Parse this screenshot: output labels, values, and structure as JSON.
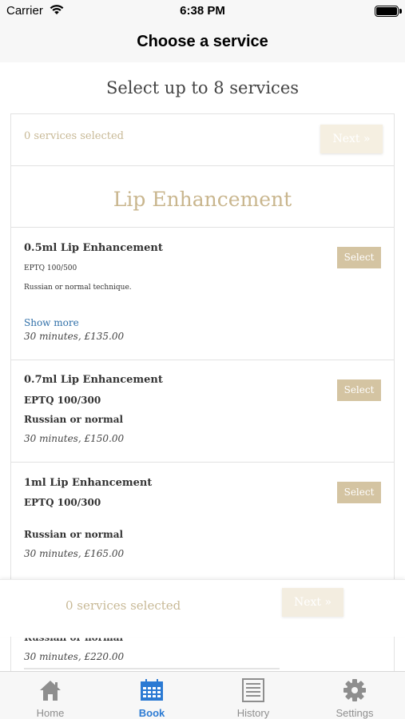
{
  "status_bar": {
    "carrier": "Carrier",
    "time": "6:38 PM"
  },
  "nav": {
    "title": "Choose a service"
  },
  "heading": "Select up to 8 services",
  "summary": {
    "selected_text": "0 services selected",
    "next_label": "Next »"
  },
  "category": {
    "title": "Lip Enhancement"
  },
  "services": [
    {
      "name": "0.5ml Lip Enhancement",
      "line1": "EPTQ 100/500",
      "line2": "Russian or normal technique.",
      "show_more": "Show more",
      "meta": "30 minutes, £135.00",
      "select_label": "Select"
    },
    {
      "name": "0.7ml Lip Enhancement",
      "line1": "EPTQ 100/300",
      "line2": "Russian or normal",
      "meta": "30 minutes, £150.00",
      "select_label": "Select"
    },
    {
      "name": "1ml Lip Enhancement",
      "line1": "EPTQ 100/300",
      "line2": "Russian or normal",
      "meta": "30 minutes, £165.00",
      "select_label": "Select"
    },
    {
      "name": "",
      "line1": "Russian or normal",
      "meta": "30 minutes, £220.00"
    }
  ],
  "floating_bar": {
    "selected_text": "0 services selected",
    "next_label": "Next »"
  },
  "tabs": [
    {
      "label": "Home",
      "icon": "home-icon"
    },
    {
      "label": "Book",
      "icon": "calendar-icon",
      "active": true
    },
    {
      "label": "History",
      "icon": "list-icon"
    },
    {
      "label": "Settings",
      "icon": "gear-icon"
    }
  ],
  "colors": {
    "accent_gold": "#c9b68e",
    "select_button": "#d4c4a2",
    "link_blue": "#2f6fa8",
    "tab_active": "#2b7ad3"
  }
}
